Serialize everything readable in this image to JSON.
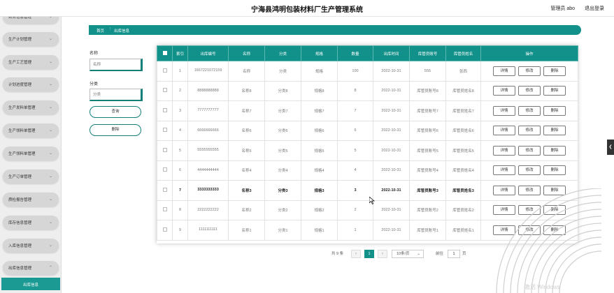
{
  "header": {
    "title": "宁海县鸿明包装材料厂生产管理系统",
    "user": "管理员 abo",
    "logout": "退出登录"
  },
  "sidebar": {
    "items": [
      {
        "label": "财务信息管理"
      },
      {
        "label": "生产计划管理"
      },
      {
        "label": "生产工艺管理"
      },
      {
        "label": "计划进度管理"
      },
      {
        "label": "生产发料单管理"
      },
      {
        "label": "生产领料单管理"
      },
      {
        "label": "生产领料单管理"
      },
      {
        "label": "生产订单管理"
      },
      {
        "label": "质检报告管理"
      },
      {
        "label": "库存信息管理"
      },
      {
        "label": "入库信息管理"
      },
      {
        "label": "出库信息管理"
      }
    ],
    "active_sub": "出库信息"
  },
  "breadcrumb": {
    "home": "首页",
    "sep": "⋮",
    "current": "出库信息"
  },
  "search": {
    "name_label": "名称",
    "name_placeholder": "名称",
    "type_label": "分类",
    "type_placeholder": "分类",
    "query_btn": "查询",
    "delete_btn": "删除"
  },
  "table": {
    "headers": [
      "索引",
      "出库编号",
      "名称",
      "分类",
      "规格",
      "数量",
      "出库时间",
      "库管员账号",
      "库管员姓名",
      "操作"
    ],
    "actions": [
      "详情",
      "修改",
      "删除"
    ],
    "rows": [
      [
        "1",
        "1667221072159",
        "名称",
        "分类",
        "规格",
        "100",
        "2022-10-31",
        "555",
        "张西"
      ],
      [
        "2",
        "8888888888",
        "名称8",
        "分类8",
        "规格8",
        "8",
        "2022-10-31",
        "库管员账号8",
        "库管员姓名8"
      ],
      [
        "3",
        "7777777777",
        "名称7",
        "分类7",
        "规格7",
        "7",
        "2022-10-31",
        "库管员账号7",
        "库管员姓名7"
      ],
      [
        "4",
        "6666666666",
        "名称6",
        "分类6",
        "规格6",
        "6",
        "2022-10-31",
        "库管员账号6",
        "库管员姓名6"
      ],
      [
        "5",
        "5555555555",
        "名称5",
        "分类5",
        "规格5",
        "5",
        "2022-10-31",
        "库管员账号5",
        "库管员姓名5"
      ],
      [
        "6",
        "4444444444",
        "名称4",
        "分类4",
        "规格4",
        "4",
        "2022-10-31",
        "库管员账号4",
        "库管员姓名4"
      ],
      [
        "7",
        "3333333333",
        "名称3",
        "分类3",
        "规格3",
        "3",
        "2022-10-31",
        "库管员账号3",
        "库管员姓名3"
      ],
      [
        "8",
        "2222222222",
        "名称2",
        "分类2",
        "规格2",
        "2",
        "2022-10-31",
        "库管员账号2",
        "库管员姓名2"
      ],
      [
        "9",
        "1111111111",
        "名称1",
        "分类1",
        "规格1",
        "1",
        "2022-10-31",
        "库管员账号1",
        "库管员姓名1"
      ]
    ],
    "bold_row": 6
  },
  "pagination": {
    "total": "共 9 条",
    "prev": "‹",
    "page": "1",
    "next": "›",
    "page_size": "10条/页",
    "goto_label": "前往",
    "goto_value": "1",
    "goto_suffix": "页"
  },
  "watermark": "激活 Windows",
  "colors": {
    "accent": "#12918a",
    "sidebar": "#d6d6d6"
  }
}
